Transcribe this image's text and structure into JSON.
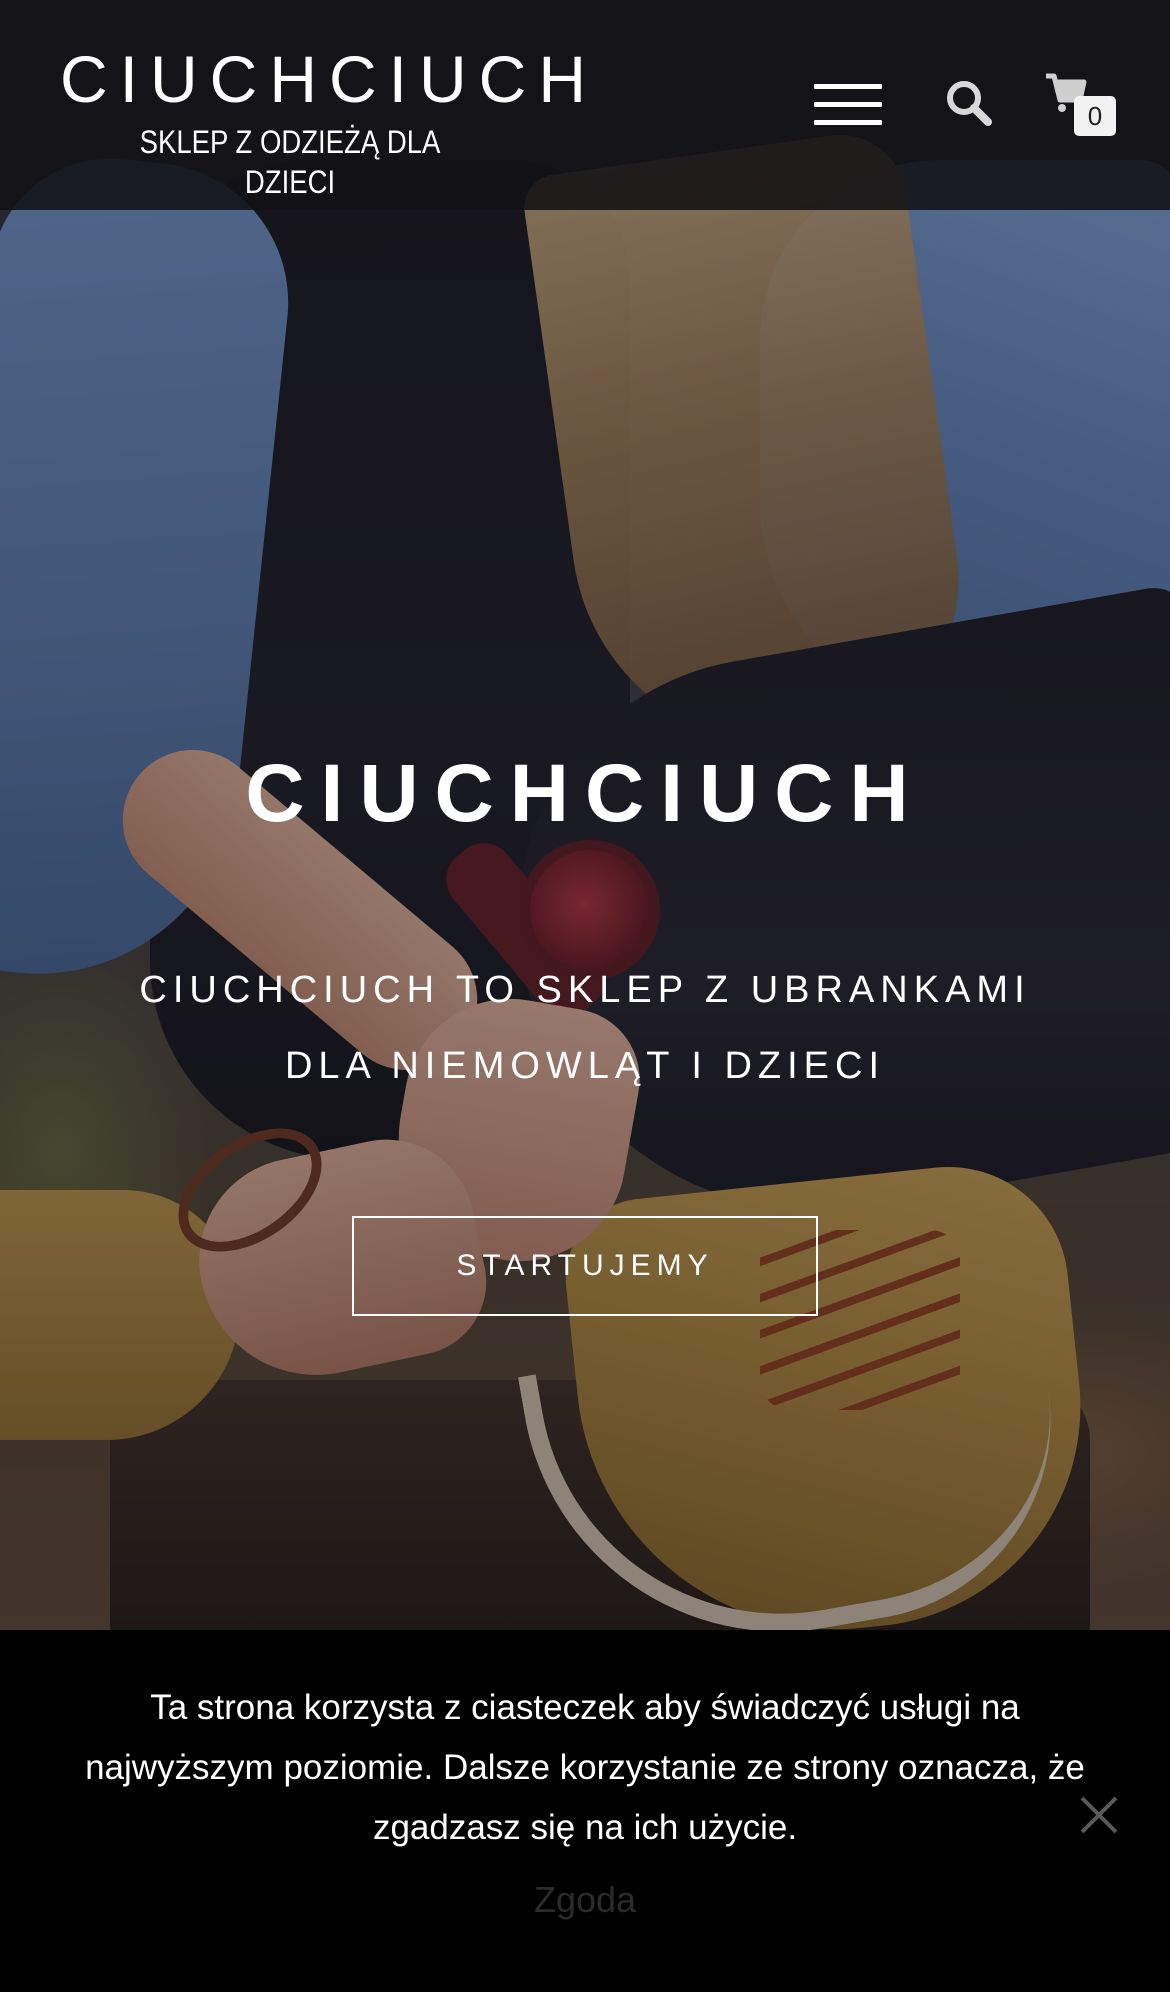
{
  "header": {
    "site_title": "CIUCHCIUCH",
    "tagline": "SKLEP Z ODZIEŻĄ DLA DZIECI",
    "menu_icon": "hamburger-menu-icon",
    "search_icon": "search-icon",
    "cart_icon": "shopping-cart-icon",
    "cart_count": "0"
  },
  "hero": {
    "title": "CIUCHCIUCH",
    "subtitle": "CIUCHCIUCH TO SKLEP Z UBRANKAMI DLA NIEMOWLĄT I DZIECI",
    "button_label": "STARTUJEMY"
  },
  "cookie_notice": {
    "text": "Ta strona korzysta z ciasteczek aby świadczyć usługi na najwyższym poziomie. Dalsze korzystanie ze strony oznacza, że zgadzasz się na ich użycie.",
    "accept_label": "Zgoda",
    "close_icon": "close-icon"
  },
  "colors": {
    "header_bg": "#121114",
    "text": "#ffffff",
    "cookie_bg": "#000000",
    "cookie_accept_text": "#2b2b2b"
  }
}
